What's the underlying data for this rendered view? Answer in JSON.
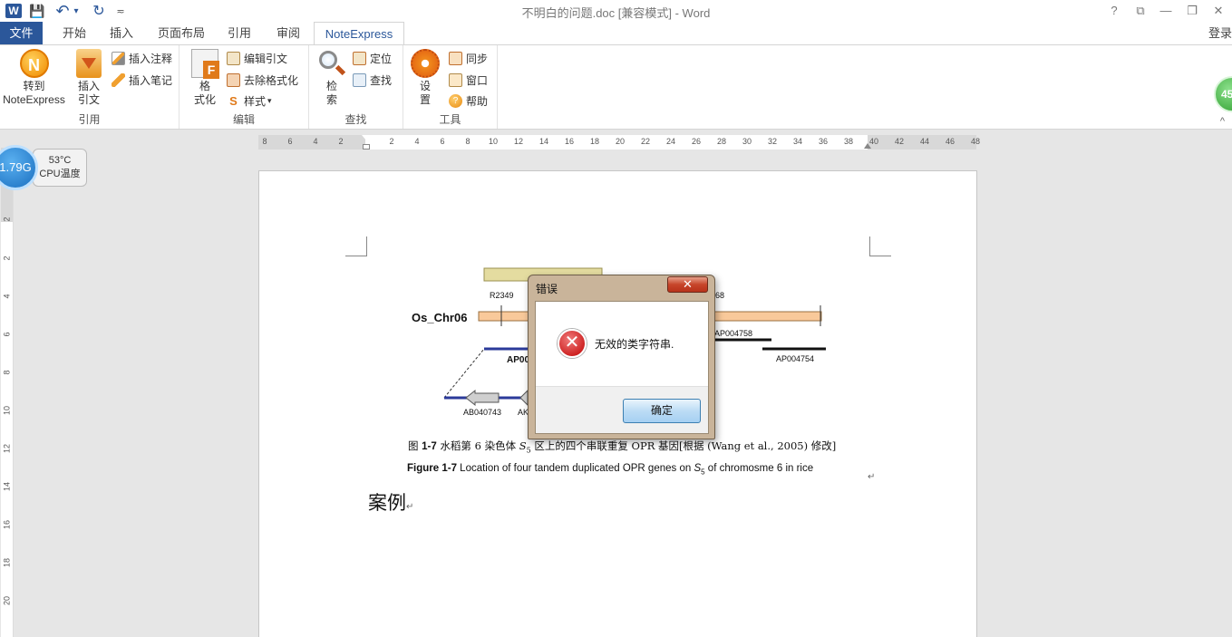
{
  "window": {
    "title": "不明白的问题.doc [兼容模式] - Word",
    "controls": {
      "help": "?",
      "restore_ribbon": "⧉",
      "minimize": "—",
      "maximize": "❐",
      "close": "✕"
    }
  },
  "quick_access": {
    "word_icon": "W",
    "save_icon": "💾",
    "undo_icon": "↶",
    "undo_dropdown": "▾",
    "redo_icon": "↻",
    "customize": "≂"
  },
  "tabs": [
    {
      "label": "文件"
    },
    {
      "label": "开始"
    },
    {
      "label": "插入"
    },
    {
      "label": "页面布局"
    },
    {
      "label": "引用"
    },
    {
      "label": "审阅"
    },
    {
      "label": "NoteExpress"
    }
  ],
  "login_label": "登录",
  "ribbon": {
    "groups": [
      {
        "label": "引用"
      },
      {
        "label": "编辑"
      },
      {
        "label": "查找"
      },
      {
        "label": "工具"
      }
    ],
    "goto_noteexpress_1": "转到",
    "goto_noteexpress_2": "NoteExpress",
    "insert_citation_1": "插入",
    "insert_citation_2": "引文",
    "insert_note": "插入注释",
    "insert_memo": "插入笔记",
    "format_1": "格",
    "format_2": "式化",
    "edit_citation": "编辑引文",
    "remove_format": "去除格式化",
    "style": "样式",
    "style_dropdown": "▾",
    "search_1": "检",
    "search_2": "索",
    "locate": "定位",
    "find": "查找",
    "settings_1": "设",
    "settings_2": "置",
    "sync": "同步",
    "window": "窗口",
    "help": "帮助",
    "collapse_icon": "^"
  },
  "ruler": {
    "h_labels": [
      "8",
      "6",
      "4",
      "2",
      "2",
      "4",
      "6",
      "8",
      "10",
      "12",
      "14",
      "16",
      "18",
      "20",
      "22",
      "24",
      "26",
      "28",
      "30",
      "32",
      "34",
      "36",
      "38",
      "40",
      "42",
      "44",
      "46",
      "48"
    ],
    "v_labels": [
      "2",
      "2",
      "4",
      "6",
      "8",
      "10",
      "12",
      "14",
      "16",
      "18",
      "20"
    ]
  },
  "cpu_widget": {
    "memory": "1.79G",
    "temp": "53°C",
    "label": "CPU温度"
  },
  "green_widget": {
    "value": "45"
  },
  "document": {
    "figure": {
      "chromosome": "Os_Chr06",
      "labels": [
        "R2349",
        "68",
        "AP004758",
        "AP004754",
        "AP00",
        "AB040743",
        "AK"
      ]
    },
    "caption_cn_prefix": "图",
    "caption_cn_num": "1-7",
    "caption_cn_text1": "水稻第 6 染色体",
    "caption_cn_s": "S",
    "caption_cn_sub": "5",
    "caption_cn_text2": "区上的四个串联重复 OPR 基因[根据 (Wang et al., 2005) 修改]",
    "caption_en_prefix": "Figure",
    "caption_en_num": "1-7",
    "caption_en_text1": "Location of four tandem duplicated OPR genes on",
    "caption_en_s": "S",
    "caption_en_sub": "5",
    "caption_en_text2": "of chromosme 6 in rice",
    "return_mark": "↵",
    "heading": "案例"
  },
  "dialog": {
    "title": "错误",
    "close_icon": "✕",
    "error_icon": "✕",
    "message": "无效的类字符串.",
    "ok_button": "确定"
  }
}
